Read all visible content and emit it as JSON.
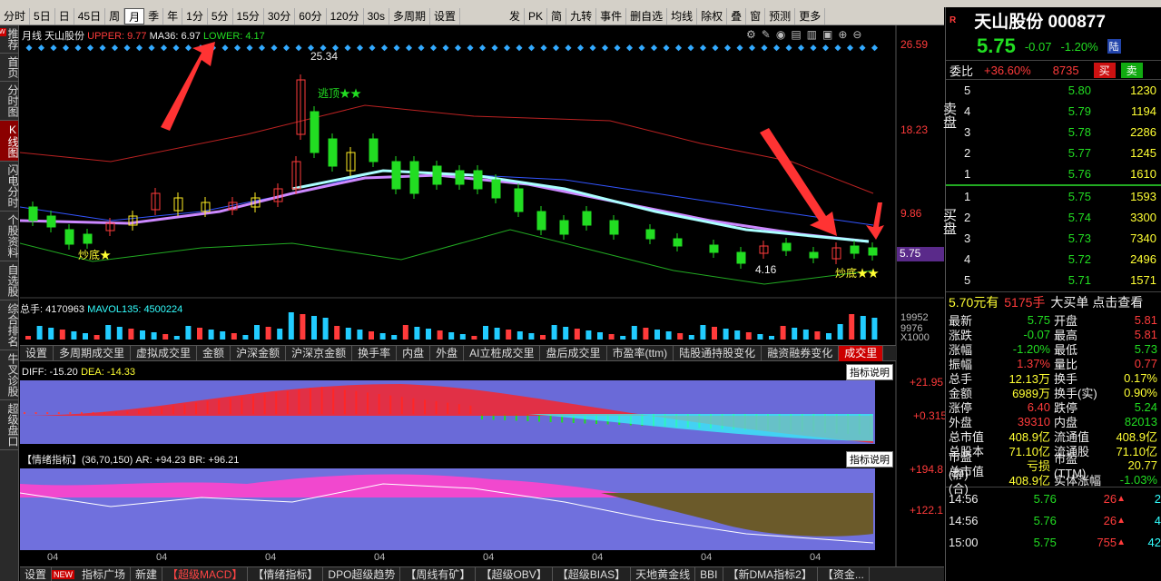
{
  "toolbar": {
    "periods": [
      "分时",
      "5日",
      "日",
      "45日",
      "周",
      "月",
      "季",
      "年",
      "1分",
      "5分",
      "15分",
      "30分",
      "60分",
      "120分",
      "30s"
    ],
    "active_period": "月",
    "multi_period": "多周期",
    "settings": "设置",
    "right_buttons": [
      "发",
      "PK",
      "简",
      "九转",
      "事件",
      "删自选",
      "均线",
      "除权",
      "叠",
      "窗",
      "预测",
      "更多"
    ]
  },
  "sidebar": {
    "items": [
      {
        "label": "推荐",
        "badge": "NEW"
      },
      {
        "label": "首页"
      },
      {
        "label": "分时图"
      },
      {
        "label": "K线图",
        "active": true
      },
      {
        "label": "闪电分时"
      },
      {
        "label": "个股资料"
      },
      {
        "label": "自选股"
      },
      {
        "label": "综合排名"
      },
      {
        "label": "牛叉诊股"
      },
      {
        "label": "超级盘口"
      }
    ]
  },
  "main_chart": {
    "period_label": "月线",
    "stock_name": "天山股份",
    "upper_label": "UPPER: 9.77",
    "ma_label": "MA36: 6.97",
    "lower_label": "LOWER: 4.17",
    "axis_labels": [
      "26.59",
      "18.23",
      "9.86",
      "5.75"
    ],
    "high_label": "25.34",
    "low_label": "4.16",
    "escape_top": "逃顶★★",
    "buy_bottom_left": "炒底★",
    "buy_bottom_right": "炒底★★",
    "q_labels": [
      "q",
      "q",
      "q",
      "q",
      "q",
      "L",
      "L",
      "Lq",
      "q",
      "L"
    ]
  },
  "volume_chart": {
    "total_label": "总手: 4170963",
    "mavol_label": "MAVOL135: 4500224",
    "axis_labels": [
      "19952",
      "9976",
      "X1000"
    ]
  },
  "indicator_tabs": [
    "设置",
    "多周期成交里",
    "虚拟成交里",
    "金额",
    "沪深金额",
    "沪深京金额",
    "换手率",
    "内盘",
    "外盘",
    "AI立桩成交里",
    "盘后成交里",
    "市盈率(ttm)",
    "陆股通持股变化",
    "融资融券变化",
    "成交里"
  ],
  "macd": {
    "diff_label": "DIFF: -15.20",
    "dea_label": "DEA: -14.33",
    "explain": "指标说明",
    "axis_labels": [
      "+21.95",
      "+0.315"
    ]
  },
  "arbr": {
    "title_label": "【情绪指标】(36,70,150) AR: +94.23",
    "br_label": "BR: +96.21",
    "explain": "指标说明",
    "axis_labels": [
      "+194.8",
      "+122.1"
    ],
    "x_labels": [
      "04",
      "04",
      "04",
      "04",
      "04",
      "04",
      "04",
      "04"
    ]
  },
  "bottom_tabs": [
    "设置",
    "指标广场",
    "新建",
    "【超级MACD】",
    "【情绪指标】",
    "DPO超级趋势",
    "【周线有矿】",
    "【超级OBV】",
    "【超级BIAS】",
    "天地黄金线",
    "BBI",
    "【新DMA指标2】",
    "【资金..."
  ],
  "bottom_new_badge": "NEW",
  "quote": {
    "title": "天山股份 000877",
    "price": "5.75",
    "change": "-0.07",
    "change_pct": "-1.20%",
    "exchange_tag": "陆",
    "wei_bi_label": "委比",
    "wei_bi": "+36.60%",
    "wei_cha": "8735",
    "buy_btn": "买",
    "sell_btn": "卖",
    "sell_label": "卖盘",
    "buy_label": "买盘",
    "asks": [
      {
        "lvl": "5",
        "price": "5.80",
        "vol": "1230"
      },
      {
        "lvl": "4",
        "price": "5.79",
        "vol": "1194"
      },
      {
        "lvl": "3",
        "price": "5.78",
        "vol": "2286"
      },
      {
        "lvl": "2",
        "price": "5.77",
        "vol": "1245"
      },
      {
        "lvl": "1",
        "price": "5.76",
        "vol": "1610"
      }
    ],
    "bids": [
      {
        "lvl": "1",
        "price": "5.75",
        "vol": "1593"
      },
      {
        "lvl": "2",
        "price": "5.74",
        "vol": "3300"
      },
      {
        "lvl": "3",
        "price": "5.73",
        "vol": "7340"
      },
      {
        "lvl": "4",
        "price": "5.72",
        "vol": "2496"
      },
      {
        "lvl": "5",
        "price": "5.71",
        "vol": "1571"
      }
    ],
    "big_order_price": "5.70元有",
    "big_order_vol": "5175手",
    "big_order_text": "大买单 点击查看",
    "stats": [
      [
        "最新",
        "5.75",
        "开盘",
        "5.81"
      ],
      [
        "涨跌",
        "-0.07",
        "最高",
        "5.81"
      ],
      [
        "涨幅",
        "-1.20%",
        "最低",
        "5.73"
      ],
      [
        "振幅",
        "1.37%",
        "量比",
        "0.77"
      ],
      [
        "总手",
        "12.13万",
        "换手",
        "0.17%"
      ],
      [
        "金额",
        "6989万",
        "换手(实)",
        "0.90%"
      ],
      [
        "涨停",
        "6.40",
        "跌停",
        "5.24"
      ],
      [
        "外盘",
        "39310",
        "内盘",
        "82013"
      ],
      [
        "总市值",
        "408.9亿",
        "流通值",
        "408.9亿"
      ],
      [
        "总股本",
        "71.10亿",
        "流通股",
        "71.10亿"
      ],
      [
        "市盈(静)",
        "亏损",
        "市盈(TTM)",
        "20.77"
      ],
      [
        "总市值(合)",
        "408.9亿",
        "实体涨幅",
        "-1.03%"
      ]
    ],
    "ticks": [
      {
        "time": "14:56",
        "price": "5.76",
        "vol": "26",
        "n": "2"
      },
      {
        "time": "14:56",
        "price": "5.76",
        "vol": "26",
        "n": "4"
      },
      {
        "time": "15:00",
        "price": "5.75",
        "vol": "755",
        "n": "42"
      }
    ]
  }
}
